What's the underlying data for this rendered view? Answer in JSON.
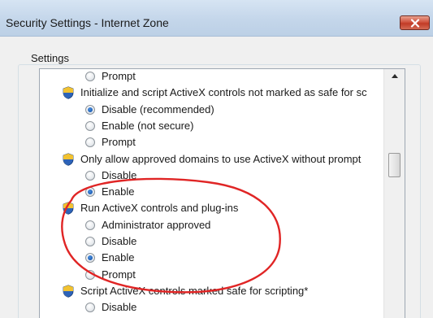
{
  "window": {
    "title": "Security Settings - Internet Zone",
    "close_icon": "close-icon"
  },
  "settings": {
    "group_label": "Settings",
    "rows": [
      {
        "kind": "option",
        "label": "Prompt",
        "checked": false
      },
      {
        "kind": "setting",
        "label": "Initialize and script ActiveX controls not marked as safe for sc",
        "icon": "shield-icon"
      },
      {
        "kind": "option",
        "label": "Disable (recommended)",
        "checked": true
      },
      {
        "kind": "option",
        "label": "Enable (not secure)",
        "checked": false
      },
      {
        "kind": "option",
        "label": "Prompt",
        "checked": false
      },
      {
        "kind": "setting",
        "label": "Only allow approved domains to use ActiveX without prompt",
        "icon": "shield-icon"
      },
      {
        "kind": "option",
        "label": "Disable",
        "checked": false
      },
      {
        "kind": "option",
        "label": "Enable",
        "checked": true
      },
      {
        "kind": "setting",
        "label": "Run ActiveX controls and plug-ins",
        "icon": "shield-icon"
      },
      {
        "kind": "option",
        "label": "Administrator approved",
        "checked": false
      },
      {
        "kind": "option",
        "label": "Disable",
        "checked": false
      },
      {
        "kind": "option",
        "label": "Enable",
        "checked": true
      },
      {
        "kind": "option",
        "label": "Prompt",
        "checked": false
      },
      {
        "kind": "setting",
        "label": "Script ActiveX controls marked safe for scripting*",
        "icon": "shield-icon"
      },
      {
        "kind": "option",
        "label": "Disable",
        "checked": false
      }
    ]
  },
  "scrollbar": {
    "up_icon": "scroll-up-arrow-icon",
    "down_icon": "scroll-down-arrow-icon"
  },
  "colors": {
    "annotation_ring": "#e02525",
    "title_bar": "#c4d6ea",
    "close_button": "#c13b26"
  }
}
